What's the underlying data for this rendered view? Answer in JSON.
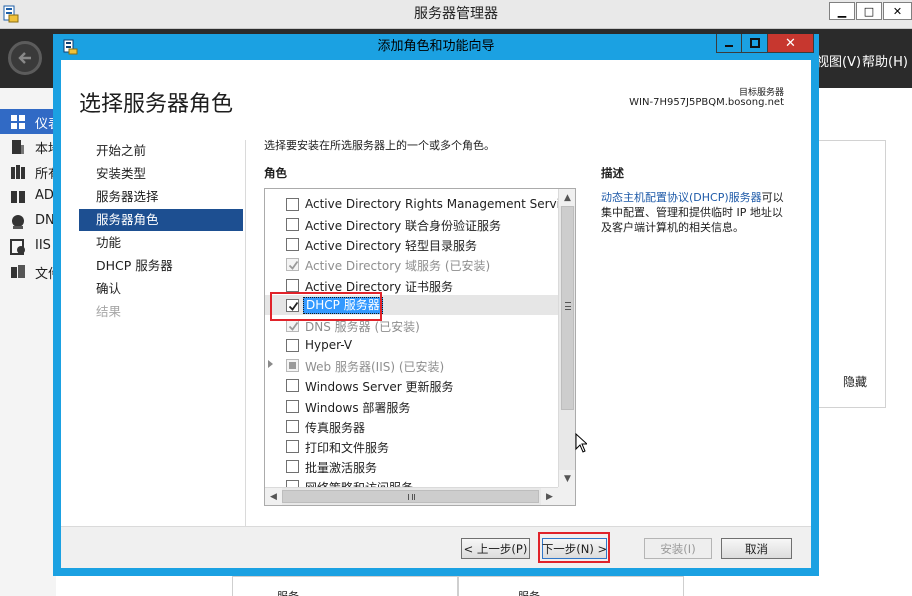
{
  "server_manager": {
    "title": "服务器管理器",
    "menu": {
      "view": "视图(V)",
      "help": "帮助(H)"
    },
    "sidebar_items": [
      {
        "label": "仪表板",
        "icon": "dashboard-icon",
        "active": true
      },
      {
        "label": "本地服务器",
        "icon": "server-icon"
      },
      {
        "label": "所有服务器",
        "icon": "servers-icon"
      },
      {
        "label": "AD DS",
        "icon": "ad-icon"
      },
      {
        "label": "DNS",
        "icon": "dns-icon"
      },
      {
        "label": "IIS",
        "icon": "iis-icon"
      },
      {
        "label": "文件和存储服务",
        "icon": "file-icon"
      }
    ],
    "hide_label": "隐藏",
    "bottom_labels": [
      "服务",
      "服务"
    ]
  },
  "wizard": {
    "title": "添加角色和功能向导",
    "heading": "选择服务器角色",
    "target_label": "目标服务器",
    "target_value": "WIN-7H957J5PBQM.bosong.net",
    "nav": [
      {
        "label": "开始之前"
      },
      {
        "label": "安装类型"
      },
      {
        "label": "服务器选择"
      },
      {
        "label": "服务器角色",
        "active": true
      },
      {
        "label": "功能"
      },
      {
        "label": "DHCP 服务器"
      },
      {
        "label": "确认"
      },
      {
        "label": "结果",
        "disabled": true
      }
    ],
    "instruction": "选择要安装在所选服务器上的一个或多个角色。",
    "roles_header": "角色",
    "description_header": "描述",
    "description_link": "动态主机配置协议(DHCP)服务器",
    "description_rest": "可以集中配置、管理和提供临时 IP 地址以及客户端计算机的相关信息。",
    "roles": [
      {
        "label": "Active Directory Rights Management Services",
        "checked": false
      },
      {
        "label": "Active Directory 联合身份验证服务",
        "checked": false
      },
      {
        "label": "Active Directory 轻型目录服务",
        "checked": false
      },
      {
        "label": "Active Directory 域服务 (已安装)",
        "checked": true,
        "disabled": true
      },
      {
        "label": "Active Directory 证书服务",
        "checked": false
      },
      {
        "label": "DHCP 服务器",
        "checked": true,
        "selected": true
      },
      {
        "label": "DNS 服务器 (已安装)",
        "checked": true,
        "disabled": true
      },
      {
        "label": "Hyper-V",
        "checked": false
      },
      {
        "label": "Web 服务器(IIS) (已安装)",
        "checked": "partial",
        "disabled": true,
        "expandable": true
      },
      {
        "label": "Windows Server 更新服务",
        "checked": false
      },
      {
        "label": "Windows 部署服务",
        "checked": false
      },
      {
        "label": "传真服务器",
        "checked": false
      },
      {
        "label": "打印和文件服务",
        "checked": false
      },
      {
        "label": "批量激活服务",
        "checked": false
      },
      {
        "label": "网络策略和访问服务",
        "checked": false
      }
    ],
    "buttons": {
      "prev": "< 上一步(P)",
      "next": "下一步(N) >",
      "install": "安装(I)",
      "cancel": "取消"
    }
  }
}
